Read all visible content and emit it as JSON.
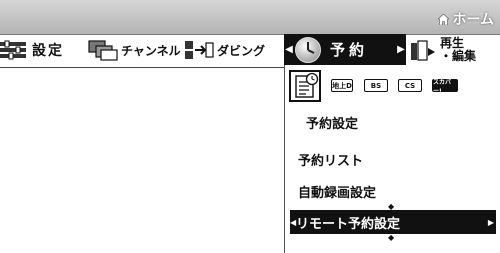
{
  "header": {
    "home_label": "ホーム"
  },
  "menu": {
    "settings_label": "設定",
    "channel_label": "チャンネル",
    "dubbing_label": "ダビング",
    "reserve_label": "予約",
    "playback_line1": "再生",
    "playback_line2": "・編集"
  },
  "submenu": {
    "broadcast_chips": [
      "地上D",
      "BS",
      "CS",
      "スカパー!"
    ],
    "title": "予約設定",
    "items": [
      "予約リスト",
      "自動録画設定",
      "リモート予約設定"
    ],
    "selected_item": "リモート予約設定"
  }
}
